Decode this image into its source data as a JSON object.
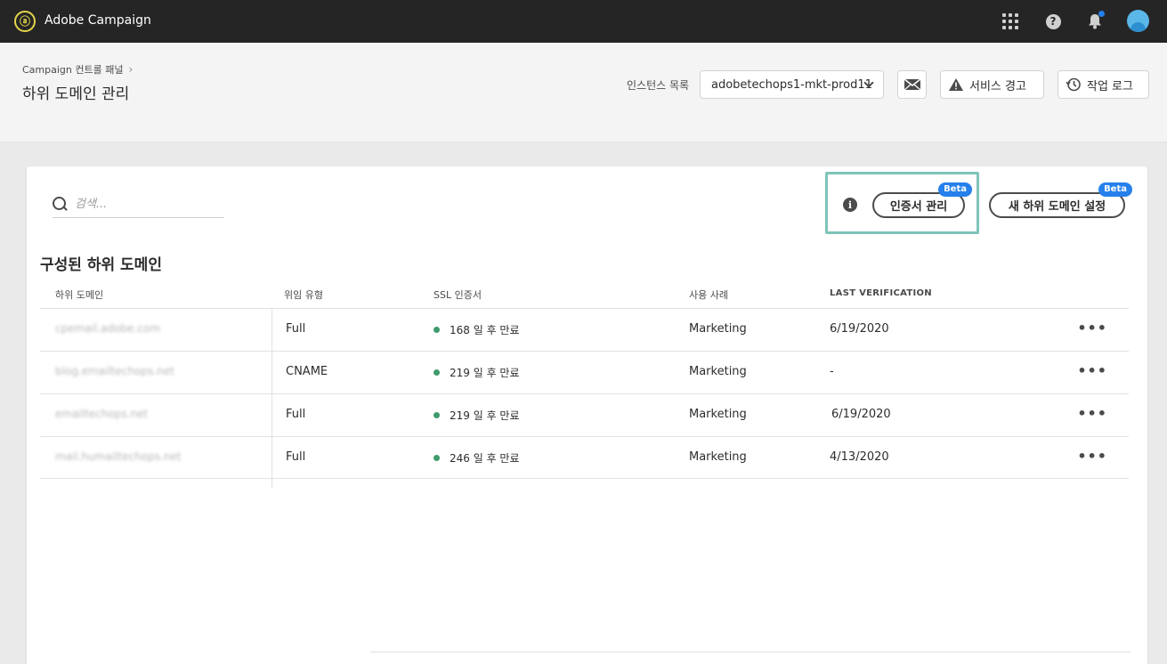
{
  "topbar": {
    "app_title": "Adobe Campaign",
    "logo_icon": "adobe-campaign-logo-icon",
    "icons": [
      "apps-grid-icon",
      "help-icon",
      "bell-icon",
      "avatar"
    ],
    "notification_dot_color": "#2680eb"
  },
  "header": {
    "breadcrumb": "Campaign 컨트롤 패널",
    "title": "하위 도메인 관리",
    "instance_label": "인스턴스 목록",
    "instance_value": "adobetechops1-mkt-prod11",
    "alerts_label": "서비스 경고",
    "job_log_label": "작업 로그"
  },
  "toolbar": {
    "search_placeholder": "검색...",
    "cert_button": "인증서 관리",
    "new_subdomain_button": "새 하위 도메인 설정",
    "beta_label": "Beta",
    "highlight_color": "#7ec4b8"
  },
  "table": {
    "title": "구성된 하위 도메인",
    "headers": {
      "subdomain": "하위 도메인",
      "delegation": "위임 유형",
      "ssl": "SSL 인증서",
      "use_case": "사용 사례",
      "last_verification": "LAST VERIFICATION"
    },
    "rows": [
      {
        "subdomain": "cpemail.adobe.com",
        "delegation": "Full",
        "ssl": "168 일 후 만료",
        "use_case": "Marketing",
        "last_verification": "6/19/2020",
        "ssl_status_color": "#3f9b6d"
      },
      {
        "subdomain": "blog.emailtechops.net",
        "delegation": "CNAME",
        "ssl": "219 일 후 만료",
        "use_case": "Marketing",
        "last_verification": "-",
        "ssl_status_color": "#3f9b6d"
      },
      {
        "subdomain": "emailtechops.net",
        "delegation": "Full",
        "ssl": "219 일 후 만료",
        "use_case": "Marketing",
        "last_verification": "6/19/2020",
        "ssl_status_color": "#3f9b6d"
      },
      {
        "subdomain": "mail.humailtechops.net",
        "delegation": "Full",
        "ssl": "246 일 후 만료",
        "use_case": "Marketing",
        "last_verification": "4/13/2020",
        "ssl_status_color": "#3f9b6d"
      }
    ],
    "row_menu": "•••"
  }
}
